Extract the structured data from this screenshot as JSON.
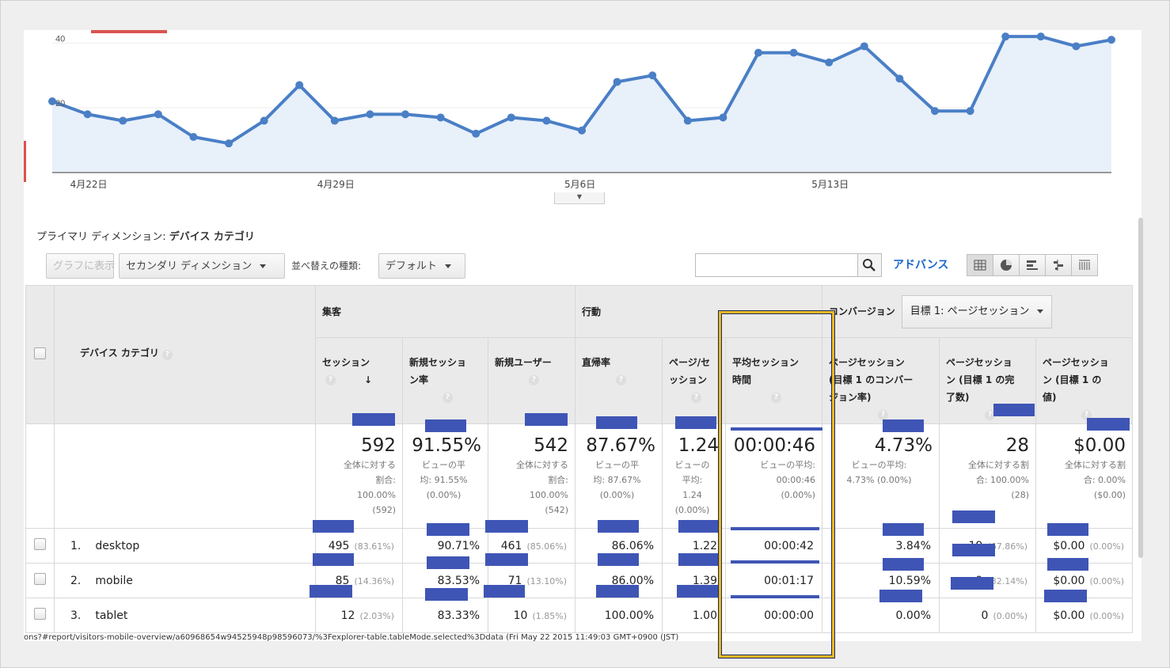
{
  "chart_data": {
    "type": "area",
    "x_tick_labels": [
      "4月22日",
      "4月29日",
      "5月6日",
      "5月13日"
    ],
    "y_tick_labels": [
      "40",
      "20"
    ],
    "ylim": [
      0,
      44
    ],
    "series": [
      {
        "values": [
          22,
          18,
          16,
          18,
          11,
          9,
          16,
          27,
          16,
          18,
          18,
          17,
          12,
          17,
          16,
          13,
          28,
          30,
          16,
          17,
          37,
          37,
          34,
          39,
          29,
          19,
          19,
          42,
          42,
          39,
          41
        ]
      }
    ],
    "color": "#4a7fc6"
  },
  "primary_dimension": {
    "label": "プライマリ ディメンション:",
    "value": "デバイス カテゴリ"
  },
  "toolbar": {
    "chart_button": "グラフに表示",
    "secondary_dimension": "セカンダリ ディメンション",
    "sort_label": "並べ替えの種類:",
    "sort_value": "デフォルト",
    "advanced": "アドバンス",
    "view_icons": [
      "table-view-icon",
      "pie-view-icon",
      "performance-view-icon",
      "comparison-view-icon",
      "pivot-view-icon"
    ]
  },
  "table": {
    "dimension_header": "デバイス カテゴリ",
    "groups": {
      "acquisition": "集客",
      "behavior": "行動",
      "conversion": "コンバージョン",
      "goal_select": "目標 1: ページセッション"
    },
    "columns": [
      {
        "label1": "セッション",
        "label2": ""
      },
      {
        "label1": "新規セッショ",
        "label2": "ン率"
      },
      {
        "label1": "新規ユーザー",
        "label2": ""
      },
      {
        "label1": "直帰率",
        "label2": ""
      },
      {
        "label1": "ページ/セ",
        "label2": "ッション"
      },
      {
        "label1": "平均セッション",
        "label2": "時間"
      },
      {
        "label1": "ページセッション",
        "label2": "(目標 1 のコンバー",
        "label3": "ジョン率)"
      },
      {
        "label1": "ページセッショ",
        "label2": "ン (目標 1 の完",
        "label3": "了数)"
      },
      {
        "label1": "ページセッショ",
        "label2": "ン (目標 1 の",
        "label3": "値)"
      }
    ],
    "totals": [
      {
        "big": "592",
        "lines": [
          "全体に対する",
          "割合:",
          "100.00%",
          "(592)"
        ]
      },
      {
        "big": "91.55%",
        "lines": [
          "ビューの平",
          "均: 91.55%",
          "(0.00%)"
        ]
      },
      {
        "big": "542",
        "lines": [
          "全体に対する",
          "割合:",
          "100.00%",
          "(542)"
        ]
      },
      {
        "big": "87.67%",
        "lines": [
          "ビューの平",
          "均: 87.67%",
          "(0.00%)"
        ]
      },
      {
        "big": "1.24",
        "lines": [
          "ビューの",
          "平均:",
          "1.24",
          "(0.00%)"
        ]
      },
      {
        "big": "00:00:46",
        "lines": [
          "ビューの平均:",
          "00:00:46",
          "(0.00%)"
        ]
      },
      {
        "big": "4.73%",
        "lines": [
          "ビューの平均:",
          "4.73% (0.00%)"
        ]
      },
      {
        "big": "28",
        "lines": [
          "全体に対する割",
          "合: 100.00%",
          "(28)"
        ]
      },
      {
        "big": "$0.00",
        "lines": [
          "全体に対する割",
          "合: 0.00%",
          "($0.00)"
        ]
      }
    ],
    "rows": [
      {
        "index": "1.",
        "device": "desktop",
        "cells": [
          {
            "v": "495",
            "p": "(83.61%)"
          },
          {
            "v": "90.71%",
            "p": ""
          },
          {
            "v": "461",
            "p": "(85.06%)"
          },
          {
            "v": "86.06%",
            "p": ""
          },
          {
            "v": "1.22",
            "p": ""
          },
          {
            "v": "00:00:42",
            "p": ""
          },
          {
            "v": "3.84%",
            "p": ""
          },
          {
            "v": "19",
            "p": "(67.86%)"
          },
          {
            "v": "$0.00",
            "p": "(0.00%)"
          }
        ]
      },
      {
        "index": "2.",
        "device": "mobile",
        "cells": [
          {
            "v": "85",
            "p": "(14.36%)"
          },
          {
            "v": "83.53%",
            "p": ""
          },
          {
            "v": "71",
            "p": "(13.10%)"
          },
          {
            "v": "86.00%",
            "p": ""
          },
          {
            "v": "1.39",
            "p": ""
          },
          {
            "v": "00:01:17",
            "p": ""
          },
          {
            "v": "10.59%",
            "p": ""
          },
          {
            "v": "9",
            "p": "(32.14%)"
          },
          {
            "v": "$0.00",
            "p": "(0.00%)"
          }
        ]
      },
      {
        "index": "3.",
        "device": "tablet",
        "cells": [
          {
            "v": "12",
            "p": "(2.03%)"
          },
          {
            "v": "83.33%",
            "p": ""
          },
          {
            "v": "10",
            "p": "(1.85%)"
          },
          {
            "v": "100.00%",
            "p": ""
          },
          {
            "v": "1.00",
            "p": ""
          },
          {
            "v": "00:00:00",
            "p": ""
          },
          {
            "v": "0.00%",
            "p": ""
          },
          {
            "v": "0",
            "p": "(0.00%)"
          },
          {
            "v": "$0.00",
            "p": "(0.00%)"
          }
        ]
      }
    ]
  },
  "url_text": "ons?#report/visitors-mobile-overview/a60968654w94525948p98596073/%3Fexplorer-table.tableMode.selected%3Ddata (Fri May 22 2015 11:49:03 GMT+0900 (JST)"
}
